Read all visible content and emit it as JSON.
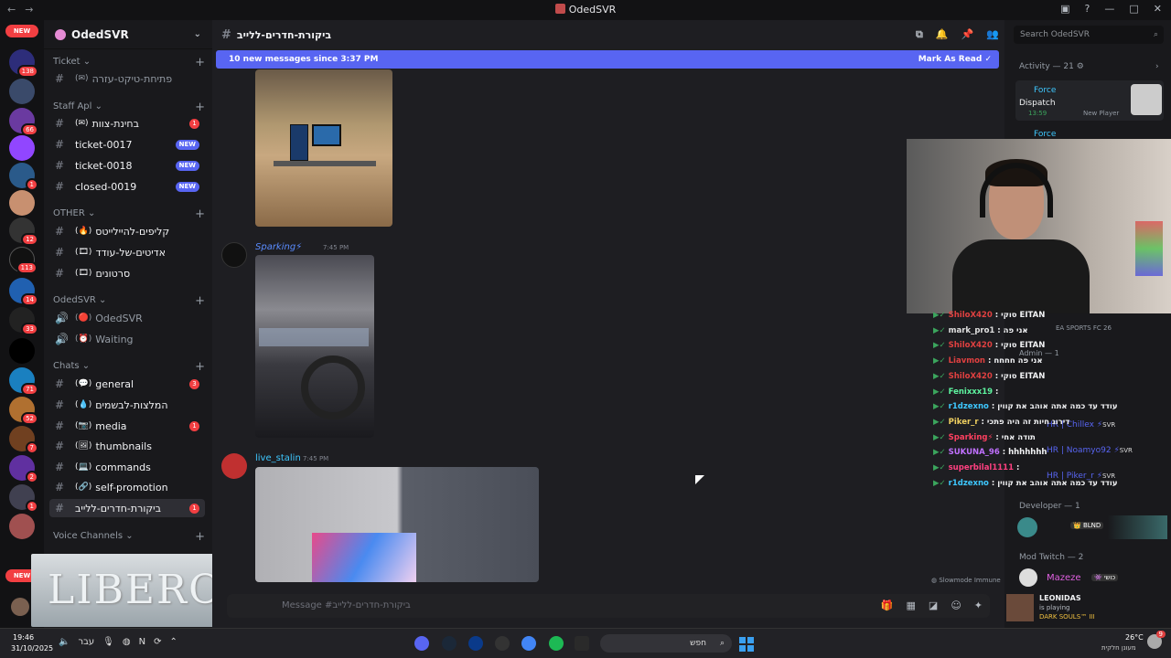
{
  "window": {
    "title": "OdedSVR"
  },
  "guilds": {
    "new_label": "NEW",
    "badges": [
      "138",
      "66",
      "12",
      "113",
      "14",
      "33",
      "71",
      "52",
      "7",
      "2",
      "1"
    ]
  },
  "server": {
    "name": "OdedSVR"
  },
  "categories": {
    "ticket": "Ticket",
    "staff": "Staff Apl",
    "other": "OTHER",
    "oded": "OdedSVR",
    "chats": "Chats",
    "voice": "Voice Channels"
  },
  "channels": {
    "ticket_open": "פתיחת-טיקט-עזרה",
    "team_review": "בחינת-צוות",
    "team_review_badge": "1",
    "t17": "ticket-0017",
    "t18": "ticket-0018",
    "c19": "closed-0019",
    "new_badge": "NEW",
    "clips": "קליפים-להיילייטס",
    "edits": "אדיטים-של-עודד",
    "videos": "סרטונים",
    "voice1": "OdedSVR",
    "voice2": "Waiting",
    "general": "general",
    "general_badge": "3",
    "recommend": "המלצות-לבשמים",
    "media": "media",
    "media_badge": "1",
    "thumbnails": "thumbnails",
    "commands": "commands",
    "selfpromo": "self-promotion",
    "room_review": "ביקורת-חדרים-ללייב",
    "room_review_badge": "1"
  },
  "header": {
    "channel": "ביקורת-חדרים-ללייב"
  },
  "new_messages": {
    "text": "10 new messages since 3:37 PM",
    "mark": "Mark As Read"
  },
  "messages": [
    {
      "user": "Sparking⚡",
      "time": "7:45 PM"
    },
    {
      "user": "live_stalin",
      "time": "7:45 PM"
    }
  ],
  "composer": {
    "placeholder": "Message #ביקורת-חדרים-ללייב"
  },
  "members": {
    "search_placeholder": "Search OdedSVR",
    "activity": "Activity — 21",
    "act1_name": "Force",
    "act1_game": "Dispatch",
    "act1_time": "13:59",
    "act1_sub": "New Player",
    "act2_name": "Force",
    "behind1": "EA SPORTS FC 26",
    "behind2": "Admin — 1",
    "developer": "Developer — 1",
    "dev_tag": "BLND",
    "mod": "Mod Twitch — 2",
    "mod_user": "Mazeze",
    "mod_tag": "כושי",
    "slowmode": "Slowmode Immune",
    "hr1": "HR | Chillex",
    "hr2": "HR | Noamyo92",
    "hr3": "HR | Piker_r",
    "svr": "SVR",
    "leonidas": "LEONIDAS",
    "leonidas_status": "is playing",
    "leonidas_game": "DARK SOULS™ III"
  },
  "stream_chat": [
    {
      "user": "ShiloX420",
      "text": ": סוקי EITAN",
      "color": "#e04040"
    },
    {
      "user": "mark_pro1",
      "text": ": אני פה",
      "color": "#e0e0e0"
    },
    {
      "user": "ShiloX420",
      "text": ": סוקי EITAN",
      "color": "#e04040"
    },
    {
      "user": "Liavmon",
      "text": ": אני פה חחחח",
      "color": "#e04040"
    },
    {
      "user": "ShiloX420",
      "text": ": סוקי EITAN",
      "color": "#e04040"
    },
    {
      "user": "Fenixxx19",
      "text": ":",
      "color": "#5ef5a0"
    },
    {
      "user": "r1dzexno",
      "text": ": עודד עד כמה אתה אוהב את קווין",
      "color": "#3ec8ff"
    },
    {
      "user": "Piker_r",
      "text": ": דירוג חיות זה היה פתכי",
      "color": "#f0d060"
    },
    {
      "user": "Sparking⚡",
      "text": ": תודה אחי",
      "color": "#ff4060"
    },
    {
      "user": "SUKUNA_96",
      "text": ": hhhhhhh",
      "color": "#c070ff"
    },
    {
      "user": "superbilal1111",
      "text": ":",
      "color": "#ff4080"
    },
    {
      "user": "r1dzexno",
      "text": ": עודד עד כמה אתה אוהב את קווין",
      "color": "#3ec8ff"
    }
  ],
  "overlay": {
    "brand": "LIBERO"
  },
  "taskbar": {
    "time": "19:46",
    "date": "31/10/2025",
    "lang": "עבר",
    "search": "חפש",
    "weather": "26°C",
    "weather_sub": "מעונן חלקית",
    "notif": "9"
  }
}
